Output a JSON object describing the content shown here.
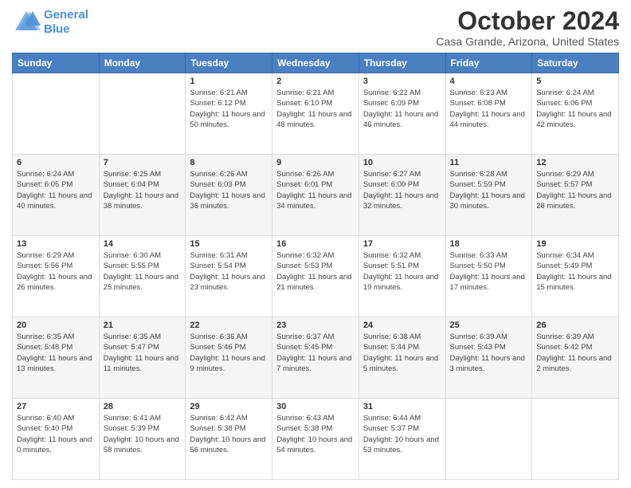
{
  "header": {
    "logo_line1": "General",
    "logo_line2": "Blue",
    "month_title": "October 2024",
    "location": "Casa Grande, Arizona, United States"
  },
  "days_of_week": [
    "Sunday",
    "Monday",
    "Tuesday",
    "Wednesday",
    "Thursday",
    "Friday",
    "Saturday"
  ],
  "weeks": [
    [
      {
        "day": "",
        "sunrise": "",
        "sunset": "",
        "daylight": ""
      },
      {
        "day": "",
        "sunrise": "",
        "sunset": "",
        "daylight": ""
      },
      {
        "day": "1",
        "sunrise": "Sunrise: 6:21 AM",
        "sunset": "Sunset: 6:12 PM",
        "daylight": "Daylight: 11 hours and 50 minutes."
      },
      {
        "day": "2",
        "sunrise": "Sunrise: 6:21 AM",
        "sunset": "Sunset: 6:10 PM",
        "daylight": "Daylight: 11 hours and 48 minutes."
      },
      {
        "day": "3",
        "sunrise": "Sunrise: 6:22 AM",
        "sunset": "Sunset: 6:09 PM",
        "daylight": "Daylight: 11 hours and 46 minutes."
      },
      {
        "day": "4",
        "sunrise": "Sunrise: 6:23 AM",
        "sunset": "Sunset: 6:08 PM",
        "daylight": "Daylight: 11 hours and 44 minutes."
      },
      {
        "day": "5",
        "sunrise": "Sunrise: 6:24 AM",
        "sunset": "Sunset: 6:06 PM",
        "daylight": "Daylight: 11 hours and 42 minutes."
      }
    ],
    [
      {
        "day": "6",
        "sunrise": "Sunrise: 6:24 AM",
        "sunset": "Sunset: 6:05 PM",
        "daylight": "Daylight: 11 hours and 40 minutes."
      },
      {
        "day": "7",
        "sunrise": "Sunrise: 6:25 AM",
        "sunset": "Sunset: 6:04 PM",
        "daylight": "Daylight: 11 hours and 38 minutes."
      },
      {
        "day": "8",
        "sunrise": "Sunrise: 6:26 AM",
        "sunset": "Sunset: 6:03 PM",
        "daylight": "Daylight: 11 hours and 36 minutes."
      },
      {
        "day": "9",
        "sunrise": "Sunrise: 6:26 AM",
        "sunset": "Sunset: 6:01 PM",
        "daylight": "Daylight: 11 hours and 34 minutes."
      },
      {
        "day": "10",
        "sunrise": "Sunrise: 6:27 AM",
        "sunset": "Sunset: 6:00 PM",
        "daylight": "Daylight: 11 hours and 32 minutes."
      },
      {
        "day": "11",
        "sunrise": "Sunrise: 6:28 AM",
        "sunset": "Sunset: 5:59 PM",
        "daylight": "Daylight: 11 hours and 30 minutes."
      },
      {
        "day": "12",
        "sunrise": "Sunrise: 6:29 AM",
        "sunset": "Sunset: 5:57 PM",
        "daylight": "Daylight: 11 hours and 28 minutes."
      }
    ],
    [
      {
        "day": "13",
        "sunrise": "Sunrise: 6:29 AM",
        "sunset": "Sunset: 5:56 PM",
        "daylight": "Daylight: 11 hours and 26 minutes."
      },
      {
        "day": "14",
        "sunrise": "Sunrise: 6:30 AM",
        "sunset": "Sunset: 5:55 PM",
        "daylight": "Daylight: 11 hours and 25 minutes."
      },
      {
        "day": "15",
        "sunrise": "Sunrise: 6:31 AM",
        "sunset": "Sunset: 5:54 PM",
        "daylight": "Daylight: 11 hours and 23 minutes."
      },
      {
        "day": "16",
        "sunrise": "Sunrise: 6:32 AM",
        "sunset": "Sunset: 5:53 PM",
        "daylight": "Daylight: 11 hours and 21 minutes."
      },
      {
        "day": "17",
        "sunrise": "Sunrise: 6:32 AM",
        "sunset": "Sunset: 5:51 PM",
        "daylight": "Daylight: 11 hours and 19 minutes."
      },
      {
        "day": "18",
        "sunrise": "Sunrise: 6:33 AM",
        "sunset": "Sunset: 5:50 PM",
        "daylight": "Daylight: 11 hours and 17 minutes."
      },
      {
        "day": "19",
        "sunrise": "Sunrise: 6:34 AM",
        "sunset": "Sunset: 5:49 PM",
        "daylight": "Daylight: 11 hours and 15 minutes."
      }
    ],
    [
      {
        "day": "20",
        "sunrise": "Sunrise: 6:35 AM",
        "sunset": "Sunset: 5:48 PM",
        "daylight": "Daylight: 11 hours and 13 minutes."
      },
      {
        "day": "21",
        "sunrise": "Sunrise: 6:35 AM",
        "sunset": "Sunset: 5:47 PM",
        "daylight": "Daylight: 11 hours and 11 minutes."
      },
      {
        "day": "22",
        "sunrise": "Sunrise: 6:36 AM",
        "sunset": "Sunset: 5:46 PM",
        "daylight": "Daylight: 11 hours and 9 minutes."
      },
      {
        "day": "23",
        "sunrise": "Sunrise: 6:37 AM",
        "sunset": "Sunset: 5:45 PM",
        "daylight": "Daylight: 11 hours and 7 minutes."
      },
      {
        "day": "24",
        "sunrise": "Sunrise: 6:38 AM",
        "sunset": "Sunset: 5:44 PM",
        "daylight": "Daylight: 11 hours and 5 minutes."
      },
      {
        "day": "25",
        "sunrise": "Sunrise: 6:39 AM",
        "sunset": "Sunset: 5:43 PM",
        "daylight": "Daylight: 11 hours and 3 minutes."
      },
      {
        "day": "26",
        "sunrise": "Sunrise: 6:39 AM",
        "sunset": "Sunset: 5:42 PM",
        "daylight": "Daylight: 11 hours and 2 minutes."
      }
    ],
    [
      {
        "day": "27",
        "sunrise": "Sunrise: 6:40 AM",
        "sunset": "Sunset: 5:40 PM",
        "daylight": "Daylight: 11 hours and 0 minutes."
      },
      {
        "day": "28",
        "sunrise": "Sunrise: 6:41 AM",
        "sunset": "Sunset: 5:39 PM",
        "daylight": "Daylight: 10 hours and 58 minutes."
      },
      {
        "day": "29",
        "sunrise": "Sunrise: 6:42 AM",
        "sunset": "Sunset: 5:38 PM",
        "daylight": "Daylight: 10 hours and 56 minutes."
      },
      {
        "day": "30",
        "sunrise": "Sunrise: 6:43 AM",
        "sunset": "Sunset: 5:38 PM",
        "daylight": "Daylight: 10 hours and 54 minutes."
      },
      {
        "day": "31",
        "sunrise": "Sunrise: 6:44 AM",
        "sunset": "Sunset: 5:37 PM",
        "daylight": "Daylight: 10 hours and 53 minutes."
      },
      {
        "day": "",
        "sunrise": "",
        "sunset": "",
        "daylight": ""
      },
      {
        "day": "",
        "sunrise": "",
        "sunset": "",
        "daylight": ""
      }
    ]
  ]
}
